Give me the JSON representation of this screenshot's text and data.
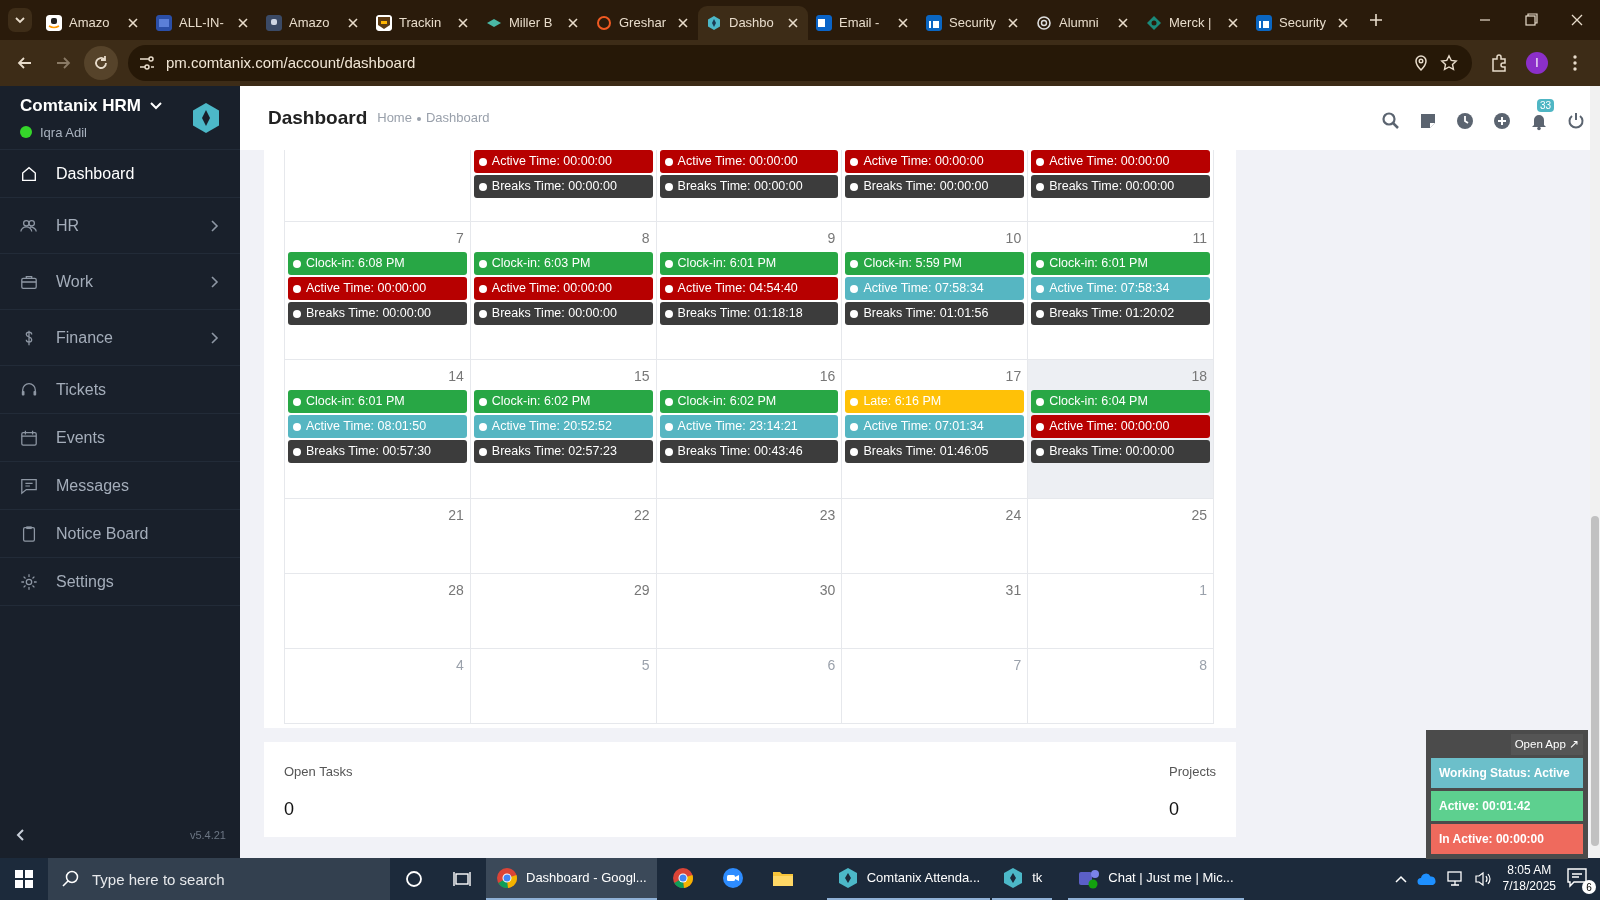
{
  "browser": {
    "tabs": [
      {
        "title": "Amazo",
        "selected": false
      },
      {
        "title": "ALL-IN-",
        "selected": false
      },
      {
        "title": "Amazo",
        "selected": false
      },
      {
        "title": "Trackin",
        "selected": false
      },
      {
        "title": "Miller B",
        "selected": false
      },
      {
        "title": "Greshar",
        "selected": false
      },
      {
        "title": "Dashbo",
        "selected": true
      },
      {
        "title": "Email -",
        "selected": false
      },
      {
        "title": "Security",
        "selected": false
      },
      {
        "title": "Alumni",
        "selected": false
      },
      {
        "title": "Merck |",
        "selected": false
      },
      {
        "title": "Security",
        "selected": false
      }
    ],
    "address": "pm.comtanix.com/account/dashboard",
    "profile_initial": "I"
  },
  "sidebar": {
    "brand": "Comtanix HRM",
    "user": "Iqra Adil",
    "online": true,
    "items": [
      {
        "label": "Dashboard",
        "selected": true,
        "has_children": false
      },
      {
        "label": "HR",
        "selected": false,
        "has_children": true
      },
      {
        "label": "Work",
        "selected": false,
        "has_children": true
      },
      {
        "label": "Finance",
        "selected": false,
        "has_children": true
      },
      {
        "label": "Tickets",
        "selected": false,
        "has_children": false
      },
      {
        "label": "Events",
        "selected": false,
        "has_children": false
      },
      {
        "label": "Messages",
        "selected": false,
        "has_children": false
      },
      {
        "label": "Notice Board",
        "selected": false,
        "has_children": false
      },
      {
        "label": "Settings",
        "selected": false,
        "has_children": false
      }
    ],
    "version": "v5.4.21"
  },
  "header": {
    "title": "Dashboard",
    "breadcrumb": [
      "Home",
      "Dashboard"
    ],
    "notification_count": "33"
  },
  "calendar": {
    "weeks": [
      {
        "days": [
          {
            "today": false
          },
          {
            "today": false,
            "events": [
              {
                "label": "Active Time: 00:00:00",
                "color": "#b70000"
              },
              {
                "label": "Breaks Time: 00:00:00",
                "color": "#3c3c3c"
              }
            ]
          },
          {
            "today": false,
            "events": [
              {
                "label": "Active Time: 00:00:00",
                "color": "#b70000"
              },
              {
                "label": "Breaks Time: 00:00:00",
                "color": "#3c3c3c"
              }
            ]
          },
          {
            "today": false,
            "events": [
              {
                "label": "Active Time: 00:00:00",
                "color": "#b70000"
              },
              {
                "label": "Breaks Time: 00:00:00",
                "color": "#3c3c3c"
              }
            ]
          },
          {
            "today": false,
            "events": [
              {
                "label": "Active Time: 00:00:00",
                "color": "#b70000"
              },
              {
                "label": "Breaks Time: 00:00:00",
                "color": "#3c3c3c"
              }
            ]
          }
        ]
      },
      {
        "days": [
          {
            "day": "7",
            "muted": false,
            "today": false,
            "events": [
              {
                "label": "Clock-in: 6:08 PM",
                "color": "#28a745"
              },
              {
                "label": "Active Time: 00:00:00",
                "color": "#b70000"
              },
              {
                "label": "Breaks Time: 00:00:00",
                "color": "#3c3c3c"
              }
            ]
          },
          {
            "day": "8",
            "muted": false,
            "today": false,
            "events": [
              {
                "label": "Clock-in: 6:03 PM",
                "color": "#28a745"
              },
              {
                "label": "Active Time: 00:00:00",
                "color": "#b70000"
              },
              {
                "label": "Breaks Time: 00:00:00",
                "color": "#3c3c3c"
              }
            ]
          },
          {
            "day": "9",
            "muted": false,
            "today": false,
            "events": [
              {
                "label": "Clock-in: 6:01 PM",
                "color": "#28a745"
              },
              {
                "label": "Active Time: 04:54:40",
                "color": "#b70000"
              },
              {
                "label": "Breaks Time: 01:18:18",
                "color": "#3c3c3c"
              }
            ]
          },
          {
            "day": "10",
            "muted": false,
            "today": false,
            "events": [
              {
                "label": "Clock-in: 5:59 PM",
                "color": "#28a745"
              },
              {
                "label": "Active Time: 07:58:34",
                "color": "#56b6c2"
              },
              {
                "label": "Breaks Time: 01:01:56",
                "color": "#3c3c3c"
              }
            ]
          },
          {
            "day": "11",
            "muted": false,
            "today": false,
            "events": [
              {
                "label": "Clock-in: 6:01 PM",
                "color": "#28a745"
              },
              {
                "label": "Active Time: 07:58:34",
                "color": "#56b6c2"
              },
              {
                "label": "Breaks Time: 01:20:02",
                "color": "#3c3c3c"
              }
            ]
          }
        ]
      },
      {
        "days": [
          {
            "day": "14",
            "muted": false,
            "today": false,
            "events": [
              {
                "label": "Clock-in: 6:01 PM",
                "color": "#28a745"
              },
              {
                "label": "Active Time: 08:01:50",
                "color": "#56b6c2"
              },
              {
                "label": "Breaks Time: 00:57:30",
                "color": "#3c3c3c"
              }
            ]
          },
          {
            "day": "15",
            "muted": false,
            "today": false,
            "events": [
              {
                "label": "Clock-in: 6:02 PM",
                "color": "#28a745"
              },
              {
                "label": "Active Time: 20:52:52",
                "color": "#56b6c2"
              },
              {
                "label": "Breaks Time: 02:57:23",
                "color": "#3c3c3c"
              }
            ]
          },
          {
            "day": "16",
            "muted": false,
            "today": false,
            "events": [
              {
                "label": "Clock-in: 6:02 PM",
                "color": "#28a745"
              },
              {
                "label": "Active Time: 23:14:21",
                "color": "#56b6c2"
              },
              {
                "label": "Breaks Time: 00:43:46",
                "color": "#3c3c3c"
              }
            ]
          },
          {
            "day": "17",
            "muted": false,
            "today": false,
            "events": [
              {
                "label": "Late: 6:16 PM",
                "color": "#ffc107"
              },
              {
                "label": "Active Time: 07:01:34",
                "color": "#56b6c2"
              },
              {
                "label": "Breaks Time: 01:46:05",
                "color": "#3c3c3c"
              }
            ]
          },
          {
            "day": "18",
            "muted": false,
            "today": true,
            "events": [
              {
                "label": "Clock-in: 6:04 PM",
                "color": "#28a745"
              },
              {
                "label": "Active Time: 00:00:00",
                "color": "#b70000"
              },
              {
                "label": "Breaks Time: 00:00:00",
                "color": "#3c3c3c"
              }
            ]
          }
        ]
      },
      {
        "days": [
          {
            "day": "21",
            "muted": false,
            "today": false
          },
          {
            "day": "22",
            "muted": false,
            "today": false
          },
          {
            "day": "23",
            "muted": false,
            "today": false
          },
          {
            "day": "24",
            "muted": false,
            "today": false
          },
          {
            "day": "25",
            "muted": false,
            "today": false
          }
        ]
      },
      {
        "days": [
          {
            "day": "28",
            "muted": false,
            "today": false
          },
          {
            "day": "29",
            "muted": false,
            "today": false
          },
          {
            "day": "30",
            "muted": false,
            "today": false
          },
          {
            "day": "31",
            "muted": false,
            "today": false
          },
          {
            "day": "1",
            "muted": true,
            "today": false
          }
        ]
      },
      {
        "days": [
          {
            "day": "4",
            "muted": true,
            "today": false
          },
          {
            "day": "5",
            "muted": true,
            "today": false
          },
          {
            "day": "6",
            "muted": true,
            "today": false
          },
          {
            "day": "7",
            "muted": true,
            "today": false
          },
          {
            "day": "8",
            "muted": true,
            "today": false
          }
        ]
      }
    ]
  },
  "stats": [
    {
      "label": "Open Tasks",
      "value": "0"
    },
    {
      "label": "Projects",
      "value": "0"
    }
  ],
  "widget": {
    "open_app": "Open App ↗",
    "rows": [
      {
        "label": "Working Status: Active",
        "color": "#6cbfca"
      },
      {
        "label": "Active: 00:01:42",
        "color": "#5dd08f"
      },
      {
        "label": "In Active: 00:00:00",
        "color": "#ef6a5d"
      }
    ]
  },
  "taskbar": {
    "search_placeholder": "Type here to search",
    "apps": [
      {
        "kind": "window",
        "label": "Dashboard - Googl...",
        "selected": true
      },
      {
        "kind": "pinned",
        "selected": false
      },
      {
        "kind": "pinned",
        "selected": false
      },
      {
        "kind": "pinned",
        "selected": false
      },
      {
        "kind": "window",
        "label": "Comtanix Attenda...",
        "selected": false
      },
      {
        "kind": "window",
        "label": "tk",
        "selected": false
      },
      {
        "kind": "window",
        "label": "Chat | Just me | Mic...",
        "selected": false
      }
    ],
    "time": "8:05 AM",
    "date": "7/18/2025",
    "notifications": "6"
  }
}
